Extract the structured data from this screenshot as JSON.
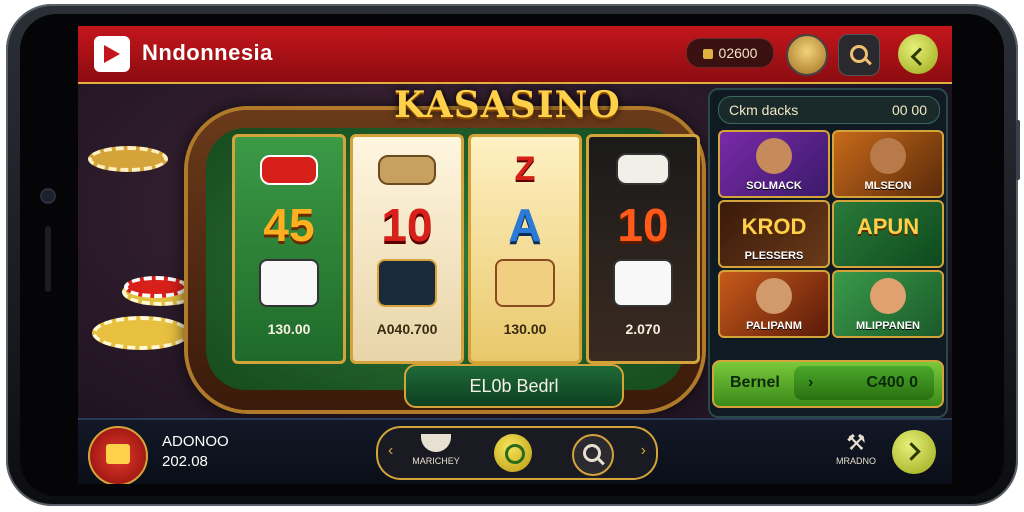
{
  "header": {
    "brand": "Nndonnesia",
    "balance": "02600"
  },
  "game": {
    "title": "KASASINO",
    "reels": [
      {
        "middle": "45",
        "amount": "130.00"
      },
      {
        "middle": "10",
        "amount": "A040.700"
      },
      {
        "middle": "A",
        "top": "Z",
        "amount": "130.00"
      },
      {
        "middle": "10",
        "amount": "2.070"
      }
    ],
    "bet_button": "EL0b Bedrl"
  },
  "panel": {
    "header_label": "Ckm dacks",
    "header_value": "00 00",
    "tiles": [
      {
        "label": "SOLMACK",
        "big": ""
      },
      {
        "label": "MLSEON",
        "big": ""
      },
      {
        "label": "PLESSERS",
        "big": "KROD"
      },
      {
        "label": "",
        "big": "APUN"
      },
      {
        "label": "PALIPANM",
        "big": ""
      },
      {
        "label": "MLIPPANEN",
        "big": ""
      }
    ],
    "bottom_label": "Bernel",
    "bottom_value": "C400 0"
  },
  "footer": {
    "user_name": "ADONOO",
    "user_value": "202.08",
    "nav_left_label": "MARICHEY",
    "tools_label": "MRADNO"
  },
  "colors": {
    "header_red": "#c4161c",
    "gold": "#d4a43a",
    "accent_lime": "#9aa818"
  }
}
